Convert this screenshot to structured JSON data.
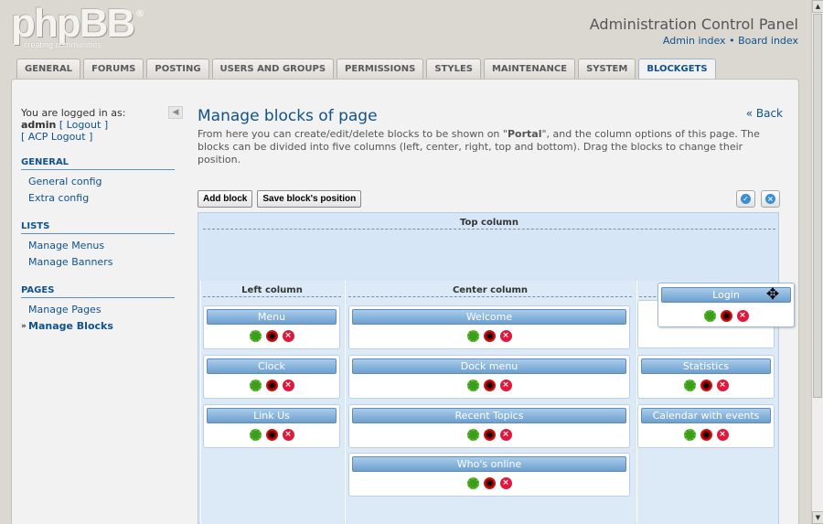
{
  "logo": {
    "word": "phpBB",
    "tagline": "creating communities",
    "reg": "®"
  },
  "header": {
    "title": "Administration Control Panel",
    "link_admin": "Admin index",
    "link_sep": "•",
    "link_board": "Board index"
  },
  "tabs": [
    {
      "label": "GENERAL"
    },
    {
      "label": "FORUMS"
    },
    {
      "label": "POSTING"
    },
    {
      "label": "USERS AND GROUPS"
    },
    {
      "label": "PERMISSIONS"
    },
    {
      "label": "STYLES"
    },
    {
      "label": "MAINTENANCE"
    },
    {
      "label": "SYSTEM"
    },
    {
      "label": "BLOCKGETS",
      "active": true
    }
  ],
  "sidebar": {
    "logged_in": "You are logged in as:",
    "user": "admin",
    "logout": "[ Logout ]",
    "acp_logout": "[ ACP Logout ]",
    "collapse_glyph": "◀",
    "sections": [
      {
        "title": "GENERAL",
        "items": [
          "General config",
          "Extra config"
        ]
      },
      {
        "title": "LISTS",
        "items": [
          "Manage Menus",
          "Manage Banners"
        ]
      },
      {
        "title": "PAGES",
        "items": [
          "Manage Pages",
          "Manage Blocks"
        ]
      }
    ]
  },
  "main": {
    "title": "Manage blocks of page",
    "back": "« Back",
    "intro_pre": "From here you can create/edit/delete blocks to be shown on \"",
    "intro_page": "Portal",
    "intro_post": "\", and the column options of this page. The blocks can be divided into five columns (left, center, right, top and bottom). Drag the blocks to change their position.",
    "add_block": "Add block",
    "save_positions": "Save block's position"
  },
  "columns": {
    "top": "Top column",
    "left": "Left column",
    "center": "Center column"
  },
  "blocks": {
    "left": [
      "Menu",
      "Clock",
      "Link Us"
    ],
    "center": [
      "Welcome",
      "Dock menu",
      "Recent Topics",
      "Who's online"
    ],
    "right": [
      "Statistics",
      "Calendar with events"
    ],
    "dragging": "Login"
  },
  "icons": {
    "confirm": "check-icon",
    "cancel": "close-icon",
    "edit": "gear-icon",
    "toggle": "stop-icon",
    "delete": "delete-icon",
    "move": "move-cursor-icon"
  },
  "colors": {
    "accent": "#105289",
    "block_bar": "#6d9fcd",
    "canvas": "#d6e6f7"
  }
}
